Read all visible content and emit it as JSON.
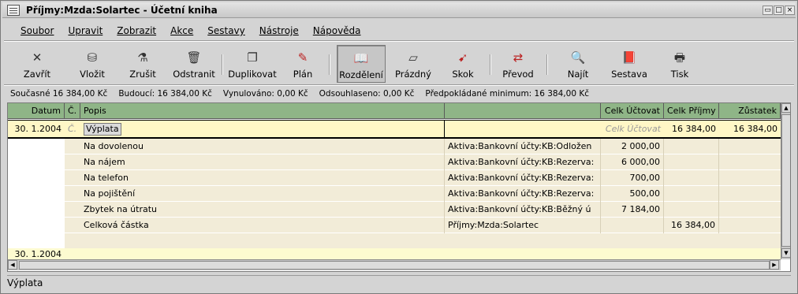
{
  "window": {
    "title": "Příjmy:Mzda:Solartec - Účetní kniha",
    "buttons": [
      "▭",
      "□",
      "×"
    ]
  },
  "menu": [
    "Soubor",
    "Upravit",
    "Zobrazit",
    "Akce",
    "Sestavy",
    "Nástroje",
    "Nápověda"
  ],
  "toolbar": [
    {
      "label": "Zavřít",
      "icon": "close-icon"
    },
    {
      "label": "Vložit",
      "icon": "enter-icon"
    },
    {
      "label": "Zrušit",
      "icon": "cancel-icon"
    },
    {
      "label": "Odstranit",
      "icon": "delete-icon"
    },
    {
      "label": "Duplikovat",
      "icon": "duplicate-icon"
    },
    {
      "label": "Plán",
      "icon": "schedule-icon"
    },
    {
      "label": "Rozdělení",
      "icon": "split-icon",
      "active": true
    },
    {
      "label": "Prázdný",
      "icon": "blank-icon"
    },
    {
      "label": "Skok",
      "icon": "jump-icon"
    },
    {
      "label": "Převod",
      "icon": "transfer-icon"
    },
    {
      "label": "Najít",
      "icon": "find-icon"
    },
    {
      "label": "Sestava",
      "icon": "report-icon"
    },
    {
      "label": "Tisk",
      "icon": "print-icon"
    }
  ],
  "summary": {
    "current": "Současné 16 384,00 Kč",
    "future": "Budoucí: 16 384,00 Kč",
    "cleared": "Vynulováno: 0,00 Kč",
    "reconciled": "Odsouhlaseno: 0,00 Kč",
    "projected": "Předpokládané minimum: 16 384,00 Kč"
  },
  "columns": {
    "date": "Datum",
    "num": "Č.",
    "desc": "Popis",
    "transfer": "",
    "debit": "Celk Účtovat",
    "credit": "Celk Příjmy",
    "balance": "Zůstatek"
  },
  "transaction": {
    "date": "30. 1.2004",
    "num": "Č.",
    "desc": "Výplata",
    "debit_placeholder": "Celk Účtovat",
    "credit": "16 384,00",
    "balance": "16 384,00"
  },
  "splits": [
    {
      "memo": "Na dovolenou",
      "account": "Aktiva:Bankovní účty:KB:Odložen",
      "debit": "2 000,00",
      "credit": ""
    },
    {
      "memo": "Na nájem",
      "account": "Aktiva:Bankovní účty:KB:Rezerva:",
      "debit": "6 000,00",
      "credit": ""
    },
    {
      "memo": "Na telefon",
      "account": "Aktiva:Bankovní účty:KB:Rezerva:",
      "debit": "700,00",
      "credit": ""
    },
    {
      "memo": "Na pojištění",
      "account": "Aktiva:Bankovní účty:KB:Rezerva:",
      "debit": "500,00",
      "credit": ""
    },
    {
      "memo": "Zbytek na útratu",
      "account": "Aktiva:Bankovní účty:KB:Běžný ú",
      "debit": "7 184,00",
      "credit": ""
    },
    {
      "memo": "Celková částka",
      "account": "Příjmy:Mzda:Solartec",
      "debit": "",
      "credit": "16 384,00"
    }
  ],
  "blank_row": {
    "date": "30. 1.2004"
  },
  "statusbar": "Výplata"
}
